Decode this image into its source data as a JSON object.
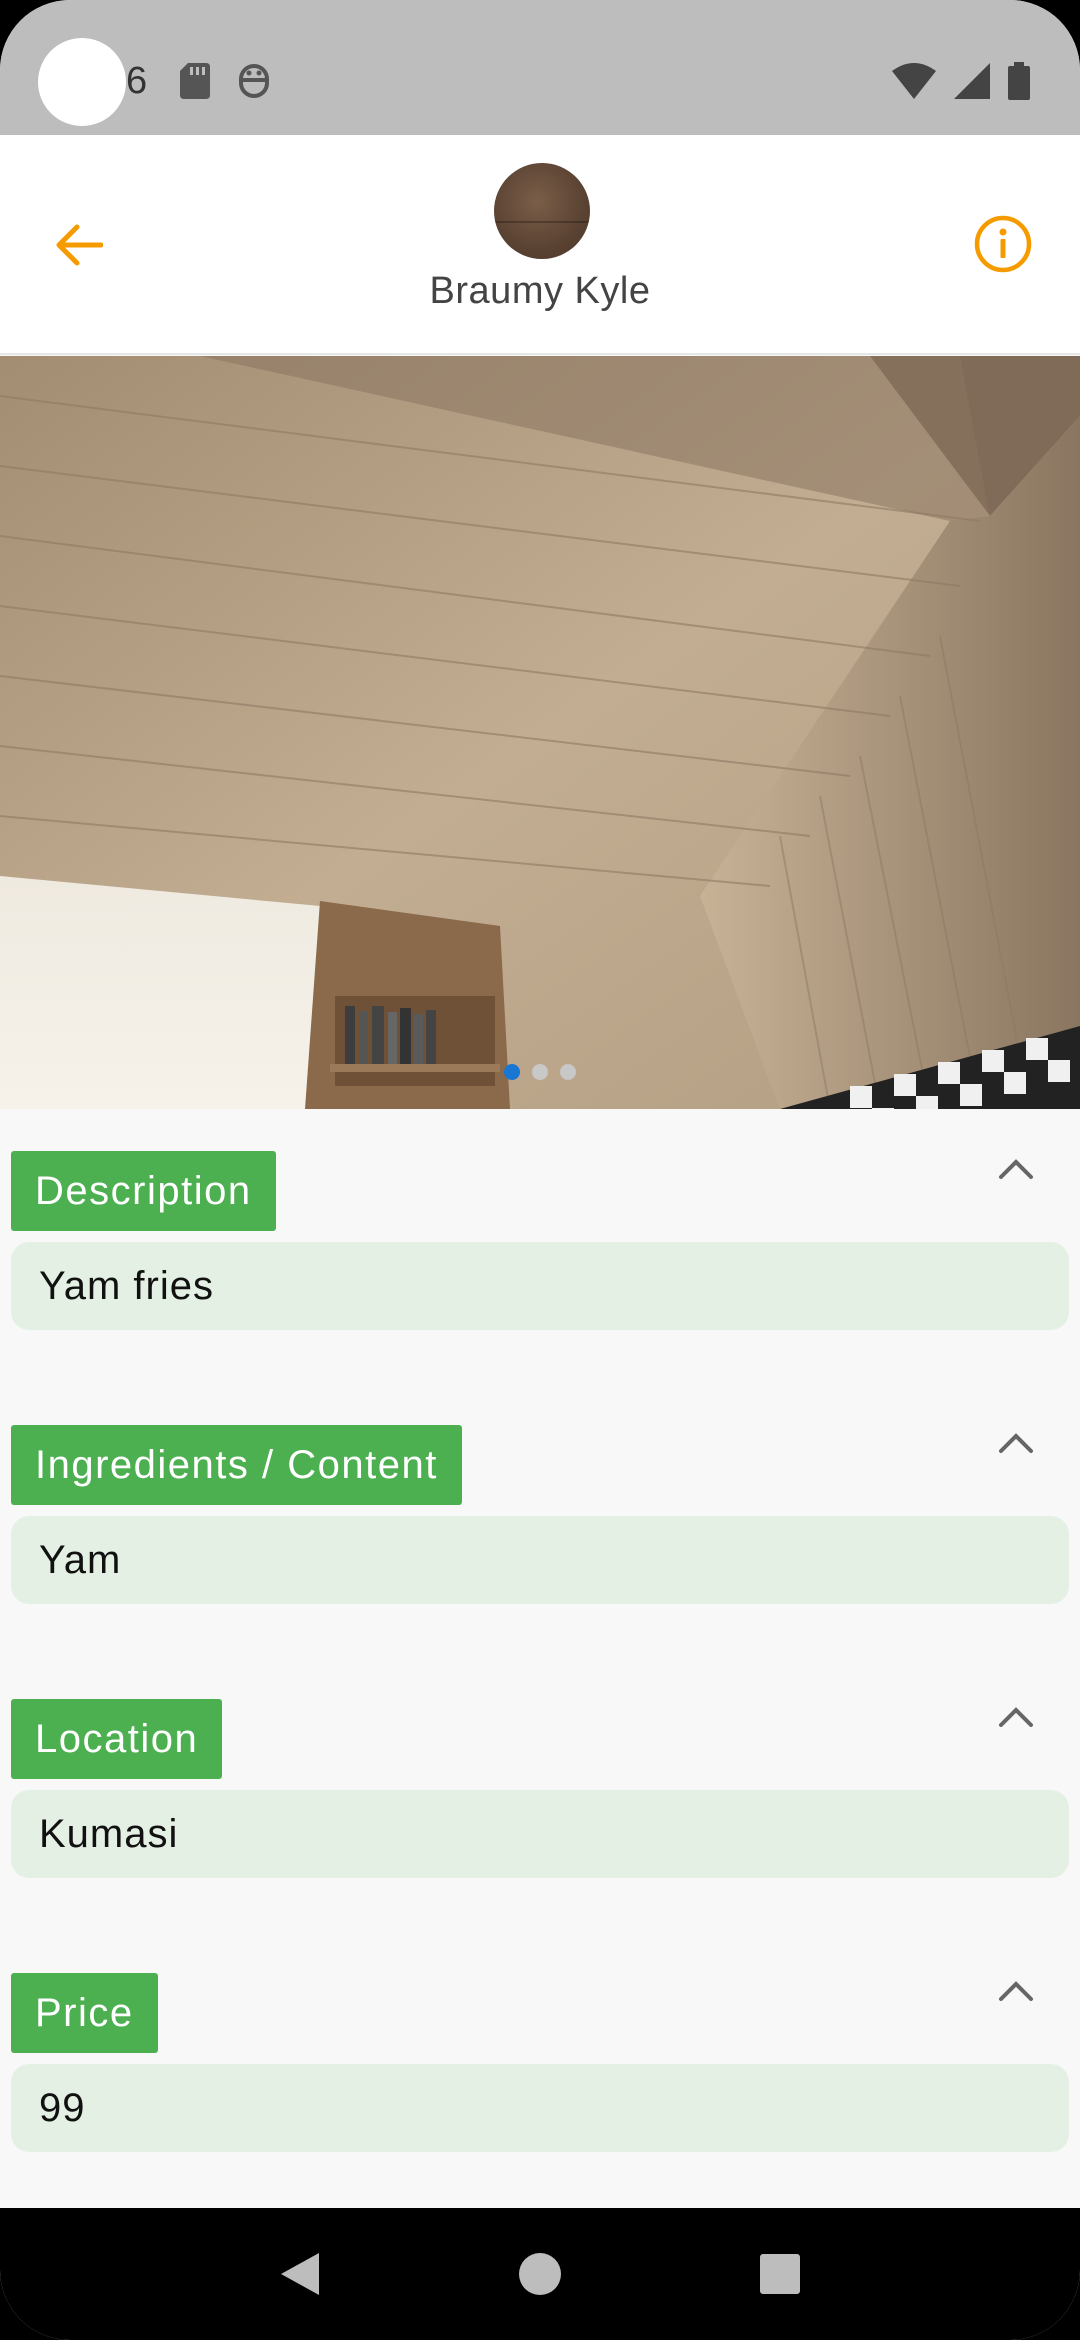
{
  "status_bar": {
    "time": "6",
    "left_icons": [
      "sd-card-icon",
      "robot-icon"
    ],
    "right_icons": [
      "wifi-icon",
      "cellular-signal-icon",
      "battery-icon"
    ]
  },
  "header": {
    "back_icon": "arrow-back-icon",
    "info_icon": "info-icon",
    "name": "Braumy Kyle",
    "accent_color": "#f59b00"
  },
  "carousel": {
    "total_slides": 3,
    "active_index": 0
  },
  "sections": [
    {
      "label": "Description",
      "value": "Yam fries"
    },
    {
      "label": "Ingredients / Content",
      "value": "Yam"
    },
    {
      "label": "Location",
      "value": "Kumasi"
    },
    {
      "label": "Price",
      "value": "99"
    }
  ],
  "colors": {
    "label_bg": "#4caf50",
    "value_bg": "#e5f0e5",
    "dot_active": "#1976d2"
  },
  "nav_bar": {
    "buttons": [
      "back-triangle-icon",
      "home-circle-icon",
      "recents-square-icon"
    ]
  }
}
